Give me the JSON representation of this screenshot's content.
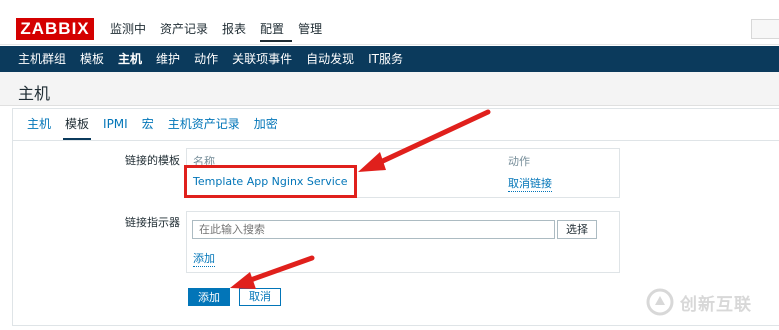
{
  "brand": {
    "logo_text": "ZABBIX",
    "accent": "#d40000"
  },
  "main_menu": [
    {
      "label": "监测中"
    },
    {
      "label": "资产记录"
    },
    {
      "label": "报表"
    },
    {
      "label": "配置",
      "active": true
    },
    {
      "label": "管理"
    }
  ],
  "sub_menu": [
    {
      "label": "主机群组"
    },
    {
      "label": "模板"
    },
    {
      "label": "主机",
      "active": true
    },
    {
      "label": "维护"
    },
    {
      "label": "动作"
    },
    {
      "label": "关联项事件"
    },
    {
      "label": "自动发现"
    },
    {
      "label": "IT服务"
    }
  ],
  "page": {
    "title": "主机"
  },
  "tabs": [
    {
      "label": "主机"
    },
    {
      "label": "模板",
      "active": true
    },
    {
      "label": "IPMI"
    },
    {
      "label": "宏"
    },
    {
      "label": "主机资产记录"
    },
    {
      "label": "加密"
    }
  ],
  "form": {
    "linked_templates": {
      "label": "链接的模板",
      "col_name": "名称",
      "col_action": "动作",
      "rows": [
        {
          "name": "Template App Nginx Service",
          "action": "取消链接"
        }
      ]
    },
    "link_new": {
      "label": "链接指示器",
      "search_placeholder": "在此输入搜索",
      "select_label": "选择",
      "add_link": "添加"
    },
    "buttons": {
      "add": "添加",
      "cancel": "取消"
    }
  },
  "watermark": {
    "text": "创新互联",
    "icon": "brand-logo-icon"
  },
  "colors": {
    "nav_bg": "#0b3a5c",
    "link": "#0275b8",
    "annotation": "#e0201c"
  }
}
